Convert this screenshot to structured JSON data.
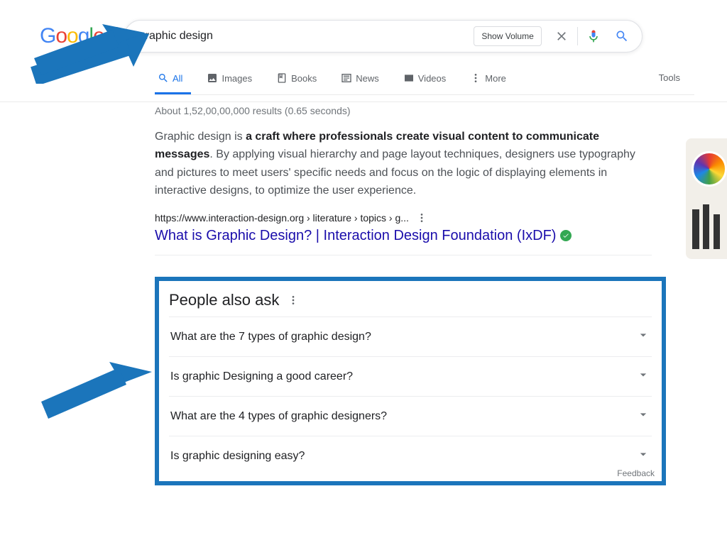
{
  "logo": {
    "g1": "G",
    "o1": "o",
    "o2": "o",
    "g2": "g",
    "l1": "l",
    "e1": "e"
  },
  "search": {
    "value": "graphic design",
    "show_volume": "Show Volume"
  },
  "nav": {
    "all": "All",
    "images": "Images",
    "books": "Books",
    "news": "News",
    "videos": "Videos",
    "more": "More",
    "tools": "Tools"
  },
  "stats": "About 1,52,00,00,000 results (0.65 seconds)",
  "snippet": {
    "lead": "Graphic design is ",
    "bold": "a craft where professionals create visual content to communicate messages",
    "rest": ". By applying visual hierarchy and page layout techniques, designers use typography and pictures to meet users' specific needs and focus on the logic of displaying elements in interactive designs, to optimize the user experience."
  },
  "result": {
    "cite": "https://www.interaction-design.org › literature › topics › g...",
    "title": "What is Graphic Design? | Interaction Design Foundation (IxDF)"
  },
  "paa": {
    "title": "People also ask",
    "q1": "What are the 7 types of graphic design?",
    "q2": "Is graphic Designing a good career?",
    "q3": "What are the 4 types of graphic designers?",
    "q4": "Is graphic designing easy?",
    "feedback": "Feedback"
  },
  "colors": {
    "annotation": "#1b75bb"
  }
}
